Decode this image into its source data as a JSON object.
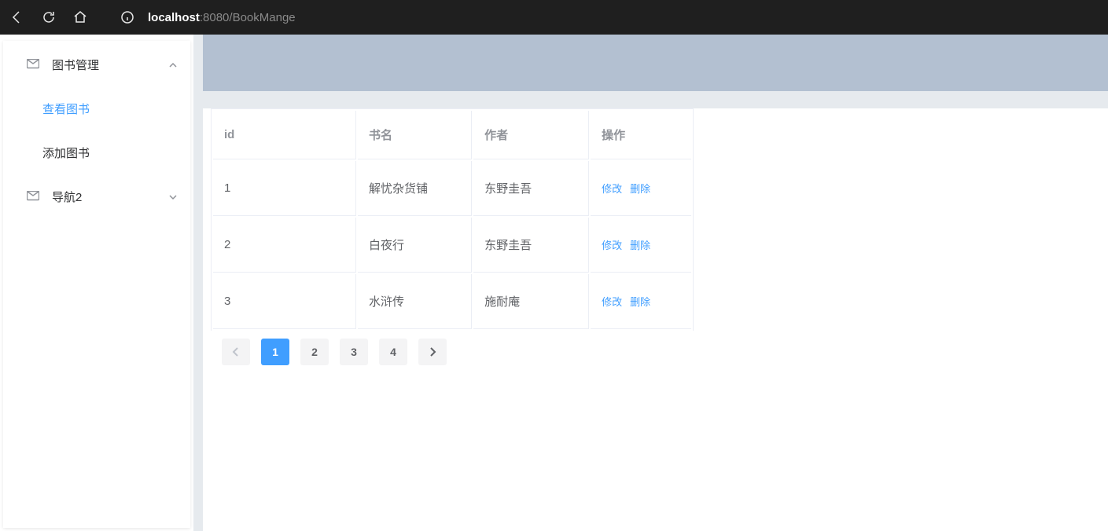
{
  "browser": {
    "url_host": "localhost",
    "url_port": ":8080",
    "url_path": "/BookMange"
  },
  "sidebar": {
    "groups": [
      {
        "label": "图书管理",
        "expanded": true,
        "items": [
          {
            "label": "查看图书",
            "active": true
          },
          {
            "label": "添加图书",
            "active": false
          }
        ]
      },
      {
        "label": "导航2",
        "expanded": false,
        "items": []
      }
    ]
  },
  "table": {
    "headers": {
      "id": "id",
      "name": "书名",
      "author": "作者",
      "action": "操作"
    },
    "rows": [
      {
        "id": "1",
        "name": "解忧杂货铺",
        "author": "东野圭吾"
      },
      {
        "id": "2",
        "name": "白夜行",
        "author": "东野圭吾"
      },
      {
        "id": "3",
        "name": "水浒传",
        "author": "施耐庵"
      }
    ],
    "actions": {
      "edit": "修改",
      "delete": "删除"
    }
  },
  "pagination": {
    "pages": [
      "1",
      "2",
      "3",
      "4"
    ],
    "current": 1
  }
}
